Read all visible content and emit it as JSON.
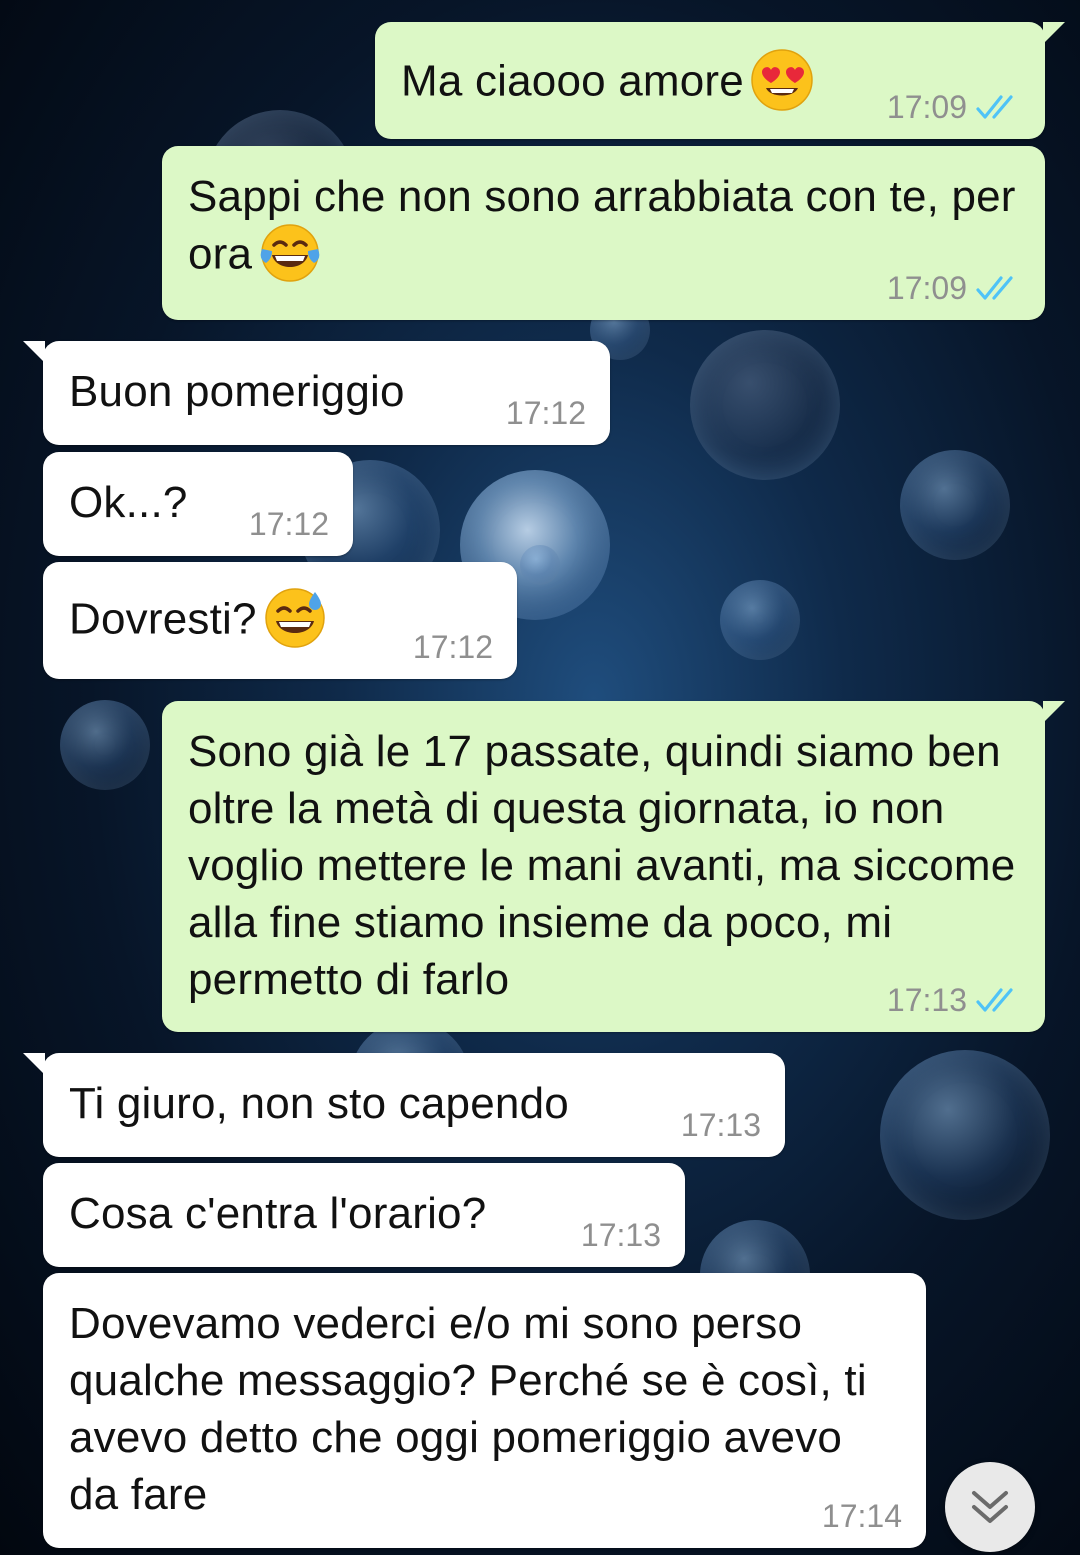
{
  "chat": {
    "messages": [
      {
        "direction": "outgoing",
        "text": "Ma ciaooo amore",
        "emoji": "heart-eyes-emoji",
        "time": "17:09",
        "status": "read"
      },
      {
        "direction": "outgoing",
        "text": "Sappi che non sono arrabbiata con te, per ora",
        "emoji": "tears-of-joy-emoji",
        "time": "17:09",
        "status": "read"
      },
      {
        "direction": "incoming",
        "text": "Buon pomeriggio",
        "time": "17:12"
      },
      {
        "direction": "incoming",
        "text": "Ok...?",
        "time": "17:12"
      },
      {
        "direction": "incoming",
        "text": "Dovresti?",
        "emoji": "grinning-sweat-emoji",
        "time": "17:12"
      },
      {
        "direction": "outgoing",
        "text": "Sono già le 17 passate, quindi siamo ben oltre la metà di questa giornata, io non voglio mettere le mani avanti, ma siccome alla fine stiamo insieme da poco, mi permetto di farlo",
        "time": "17:13",
        "status": "read"
      },
      {
        "direction": "incoming",
        "text": "Ti giuro, non sto capendo",
        "time": "17:13"
      },
      {
        "direction": "incoming",
        "text": "Cosa c'entra l'orario?",
        "time": "17:13"
      },
      {
        "direction": "incoming",
        "text": "Dovevamo vederci e/o mi sono perso qualche messaggio? Perché se è così, ti avevo detto che oggi pomeriggio avevo da fare",
        "time": "17:14"
      }
    ],
    "scroll_button_icon": "double-chevron-down-icon"
  },
  "colors": {
    "outgoing_bubble": "#dcf8c6",
    "incoming_bubble": "#ffffff",
    "timestamp": "#8f8f8f",
    "read_ticks": "#4fc3f7"
  }
}
